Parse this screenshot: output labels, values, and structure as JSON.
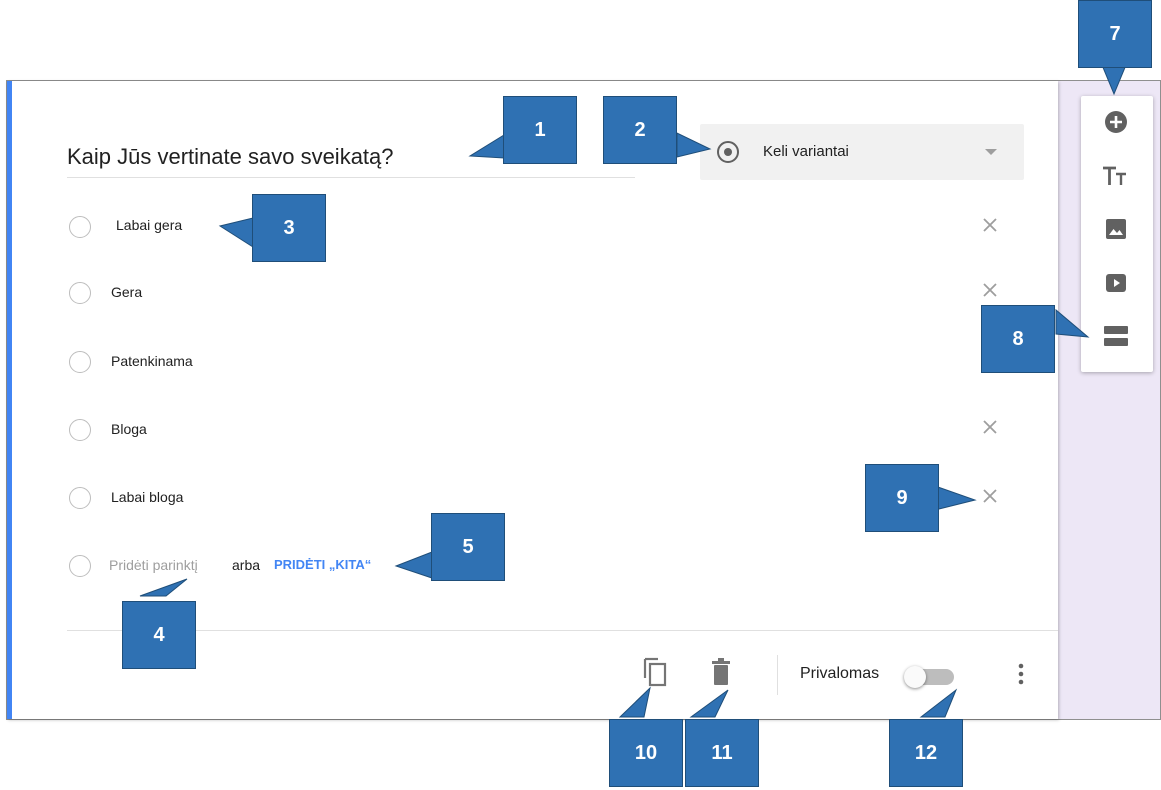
{
  "question": {
    "title": "Kaip Jūs vertinate savo sveikatą?",
    "type_label": "Keli variantai"
  },
  "options": [
    {
      "label": "Labai gera",
      "removable": true
    },
    {
      "label": "Gera",
      "removable": true
    },
    {
      "label": "Patenkinama",
      "removable": false
    },
    {
      "label": "Bloga",
      "removable": true
    },
    {
      "label": "Labai bloga",
      "removable": true
    }
  ],
  "add_option": {
    "add_label": "Pridėti parinktį",
    "or_label": "arba",
    "add_other_label": "PRIDĖTI „KITA“"
  },
  "footer": {
    "required_label": "Privalomas",
    "required_on": false
  },
  "toolbar_icons": [
    "add-circle-icon",
    "title-text-icon",
    "image-icon",
    "video-icon",
    "section-icon"
  ],
  "callouts": [
    "1",
    "2",
    "3",
    "4",
    "5",
    "7",
    "8",
    "9",
    "10",
    "11",
    "12"
  ],
  "colors": {
    "accent": "#4285f4",
    "callout": "#2f71b3",
    "sidebar_bg": "#ede7f6",
    "add_other": "#4285f4"
  }
}
